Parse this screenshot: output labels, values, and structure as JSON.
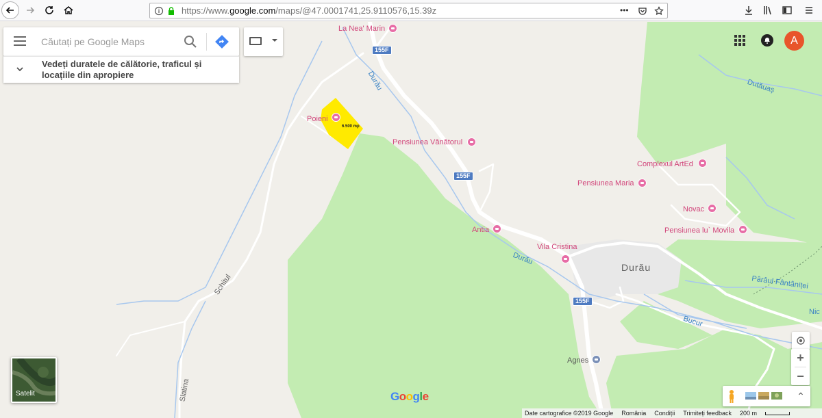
{
  "browser": {
    "url_prefix": "https://www.",
    "url_host": "google.com",
    "url_path": "/maps/@47.0001741,25.9110576,15.39z",
    "more_label": "•••"
  },
  "search": {
    "placeholder": "Căutați pe Google Maps",
    "travel_text": "Vedeți duratele de călătorie, traficul și locațiile din apropiere"
  },
  "account": {
    "avatar_letter": "A"
  },
  "map": {
    "town": "Durău",
    "pois": {
      "la_nea_marin": "La Nea' Marin",
      "poieni": "Poieni",
      "pensiunea_vanatorul": "Pensiunea Vânătorul",
      "complexul_arted": "Complexul ArtEd",
      "pensiunea_maria": "Pensiunea Maria",
      "novac": "Novac",
      "pensiunea_lu_movila": "Pensiunea lu` Movila",
      "antia": "Antia",
      "vila_cristina": "Vila Cristina",
      "agnes": "Agnes"
    },
    "waters": {
      "dutauas": "Dutăuaș",
      "durau_top": "Durău",
      "durau_mid": "Durău",
      "paraul_fantanitei": "Pârâul Fântâniței",
      "bucur": "Bucur",
      "nic": "Nic",
      "schitul": "Schitul",
      "slatina": "Slatina"
    },
    "road_shields": [
      "155F",
      "155F",
      "155F"
    ],
    "plot_label": "6.500 mp",
    "plot_color": "#ffea00",
    "forest_color": "#c3ecb2"
  },
  "controls": {
    "zoom_in": "+",
    "zoom_out": "−",
    "satellite_label": "Satelit",
    "expand": "⌃"
  },
  "branding": {
    "google": [
      "G",
      "o",
      "o",
      "g",
      "l",
      "e"
    ]
  },
  "footer": {
    "data": "Date cartografice ©2019 Google",
    "country": "România",
    "terms": "Condiții",
    "feedback": "Trimiteți feedback",
    "scale": "200 m"
  }
}
